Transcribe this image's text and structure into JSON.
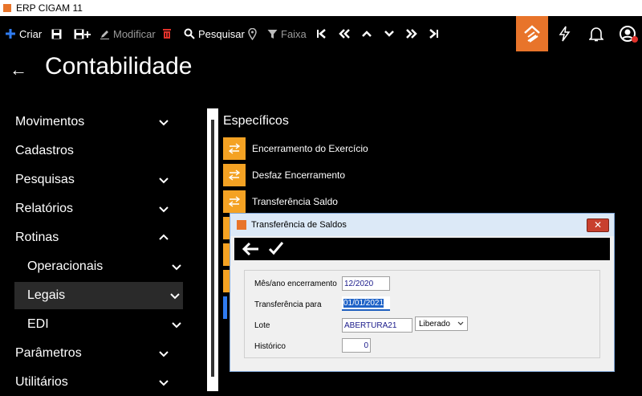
{
  "window": {
    "title": "ERP CIGAM 11"
  },
  "toolbar": {
    "criar": "Criar",
    "modificar": "Modificar",
    "pesquisar": "Pesquisar",
    "faixa": "Faixa"
  },
  "header": {
    "title": "Contabilidade"
  },
  "sidebar": {
    "items": [
      {
        "label": "Movimentos"
      },
      {
        "label": "Cadastros"
      },
      {
        "label": "Pesquisas"
      },
      {
        "label": "Relatórios"
      },
      {
        "label": "Rotinas"
      },
      {
        "label": "Operacionais"
      },
      {
        "label": "Legais"
      },
      {
        "label": "EDI"
      },
      {
        "label": "Parâmetros"
      },
      {
        "label": "Utilitários"
      }
    ]
  },
  "content": {
    "section_title": "Específicos",
    "items": [
      {
        "label": "Encerramento do Exercício"
      },
      {
        "label": "Desfaz Encerramento"
      },
      {
        "label": "Transferência Saldo"
      }
    ]
  },
  "dialog": {
    "title": "Transferência de Saldos",
    "close": "✕",
    "fields": {
      "mes_ano_label": "Mês/ano encerramento",
      "mes_ano_value": "12/2020",
      "transferencia_label": "Transferência para",
      "transferencia_value": "01/01/2021",
      "lote_label": "Lote",
      "lote_value": "ABERTURA21",
      "lote_status": "Liberado",
      "historico_label": "Histórico",
      "historico_value": "0"
    }
  },
  "colors": {
    "accent": "#e8742a",
    "item_icon": "#f4a223",
    "background": "#000000"
  }
}
